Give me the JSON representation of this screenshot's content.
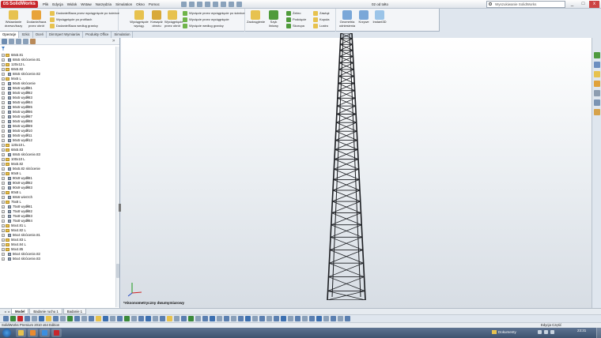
{
  "titlebar": {
    "logo": "SolidWorks",
    "menu": [
      "Plik",
      "Edycja",
      "Widok",
      "Wstaw",
      "Narzędzia",
      "Simulation",
      "Okno",
      "Pomoc"
    ],
    "document_title": "02 od tołto",
    "search_placeholder": "Wyszukiwanie SolidWorks",
    "controls": [
      "_",
      "□",
      "x"
    ]
  },
  "ribbon": {
    "group1": {
      "big_button": "Wstawianie drzewo/bazy",
      "big_button2": "Dodanie/baza przez obrót",
      "rows": [
        "Dodanie/Baza przez wyciągnięcie po ścieżce",
        "Wyciągnięcie po profilach",
        "Dodanie/Baza według granicy"
      ]
    },
    "group2": {
      "buttons": [
        "Wyciągnięcie wyciąg.",
        "Krawędź obrotu",
        "Wyciągnięcie przez obrót"
      ],
      "rows": [
        "Wycięcie przez wyciągnięcie po ścieżce",
        "Wycięcie przez wyciągnięcie",
        "Wycięcie według granicy"
      ]
    },
    "group3": {
      "buttons": [
        "Zaokrąglenie",
        "Szyk liniowy"
      ],
      "rows_a": [
        "Żebro",
        "Podcięcie",
        "Skorupa"
      ],
      "rows_b": [
        "Zawiąż",
        "Kopuła",
        "Lustro"
      ]
    },
    "group4": {
      "buttons": [
        "Geometria odniesienia",
        "Krzywe",
        "Instant3D"
      ]
    }
  },
  "tabs": [
    "Operacje",
    "Szkic",
    "Oceń",
    "DimXpert Wymiarów",
    "Produkty Office",
    "Simulation"
  ],
  "tree": [
    {
      "label": "68x5.81",
      "type": "folder"
    },
    {
      "label": "68x5 skrócenie.81",
      "type": "part"
    },
    {
      "label": "120x12 L",
      "type": "folder"
    },
    {
      "label": "68x5.82",
      "type": "folder"
    },
    {
      "label": "68x5 skrócenie.82",
      "type": "part"
    },
    {
      "label": "56x5 L",
      "type": "folder"
    },
    {
      "label": "56x5 skrócenie",
      "type": "part"
    },
    {
      "label": "56x5 wydłł81",
      "type": "part"
    },
    {
      "label": "56x5 wydłł82",
      "type": "part"
    },
    {
      "label": "56x5 wydłł83",
      "type": "part"
    },
    {
      "label": "56x5 wydłł84",
      "type": "part"
    },
    {
      "label": "56x5 wydłł85",
      "type": "part"
    },
    {
      "label": "56x5 wydłł86",
      "type": "part"
    },
    {
      "label": "56x5 wydłł87",
      "type": "part"
    },
    {
      "label": "56x5 wydłł88",
      "type": "part"
    },
    {
      "label": "56x5 wydłł89",
      "type": "part"
    },
    {
      "label": "56x5 wydłł10",
      "type": "part"
    },
    {
      "label": "56x5 wydłł11",
      "type": "part"
    },
    {
      "label": "56x5 wydłł12",
      "type": "part"
    },
    {
      "label": "120x10 L",
      "type": "folder"
    },
    {
      "label": "68x5.83",
      "type": "folder"
    },
    {
      "label": "68x5 skrócenie.83",
      "type": "part"
    },
    {
      "label": "100x10 L",
      "type": "folder"
    },
    {
      "label": "56x5.82",
      "type": "folder"
    },
    {
      "label": "56x5.82 skrócenie",
      "type": "part"
    },
    {
      "label": "90x9 L",
      "type": "folder"
    },
    {
      "label": "90x9 wydłł81",
      "type": "part"
    },
    {
      "label": "90x9 wydłł82",
      "type": "part"
    },
    {
      "label": "90x9 wydłł83",
      "type": "part"
    },
    {
      "label": "80x8 L",
      "type": "folder"
    },
    {
      "label": "68x6 wierzch",
      "type": "part"
    },
    {
      "label": "75x8 L",
      "type": "folder"
    },
    {
      "label": "75x8 wydłł81",
      "type": "part"
    },
    {
      "label": "75x8 wydłł82",
      "type": "part"
    },
    {
      "label": "75x8 wydłł83",
      "type": "part"
    },
    {
      "label": "75x8 wydłł84",
      "type": "part"
    },
    {
      "label": "56x4.81 L",
      "type": "folder"
    },
    {
      "label": "56x4.82 L",
      "type": "folder"
    },
    {
      "label": "56x4 skrócenie.81",
      "type": "part"
    },
    {
      "label": "56x4.83 L",
      "type": "folder"
    },
    {
      "label": "56x4.84 L",
      "type": "folder"
    },
    {
      "label": "56x4.85",
      "type": "folder"
    },
    {
      "label": "56x4 skrócenie.82",
      "type": "part"
    },
    {
      "label": "56x4 skrócenie.83",
      "type": "part"
    }
  ],
  "viewport": {
    "view_label": "*Aksonometryczny dwumymiarowy"
  },
  "model_tabs": [
    "Model",
    "Badanie ruchu 1",
    "Badanie 1"
  ],
  "statusbar": {
    "left": "SolidWorks Premium 2010 x64 Edition",
    "right": "Edycja Część"
  },
  "taskbar": {
    "docs_label": "Dokumenty",
    "time": "23:31",
    "date": ""
  },
  "colors": {
    "accent": "#c8262b",
    "tower": "#1b1d21",
    "folder": "#e7c24f"
  }
}
